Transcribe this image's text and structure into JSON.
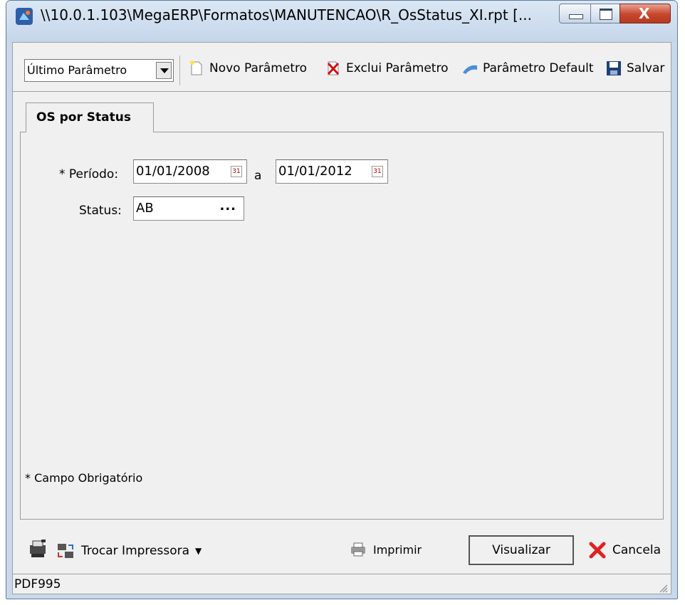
{
  "window": {
    "title": "\\\\10.0.1.103\\MegaERP\\Formatos\\MANUTENCAO\\R_OsStatus_XI.rpt [..."
  },
  "toolbar": {
    "param_select_value": "Último Parâmetro",
    "new_param_label": "Novo Parâmetro",
    "delete_param_label": "Exclui Parâmetro",
    "default_param_label": "Parâmetro Default",
    "save_label": "Salvar"
  },
  "tab": {
    "label": "OS por Status"
  },
  "form": {
    "period_label": "* Período:",
    "period_from": "01/01/2008",
    "period_separator": "a",
    "period_to": "01/01/2012",
    "status_label": "Status:",
    "status_value": "AB",
    "status_button": "...",
    "required_note": "* Campo Obrigatório"
  },
  "bottom": {
    "change_printer_label": "Trocar Impressora",
    "print_label": "Imprimir",
    "preview_label": "Visualizar",
    "cancel_label": "Cancela"
  },
  "statusbar": {
    "printer": "PDF995"
  },
  "icons": {
    "app": "crystal-report-icon",
    "new": "new-document-icon",
    "delete": "delete-document-icon",
    "default": "default-param-icon",
    "save": "floppy-disk-icon",
    "printer_setup": "printer-setup-icon",
    "change_printer": "change-printer-icon",
    "print": "printer-icon",
    "cancel": "red-x-icon"
  }
}
